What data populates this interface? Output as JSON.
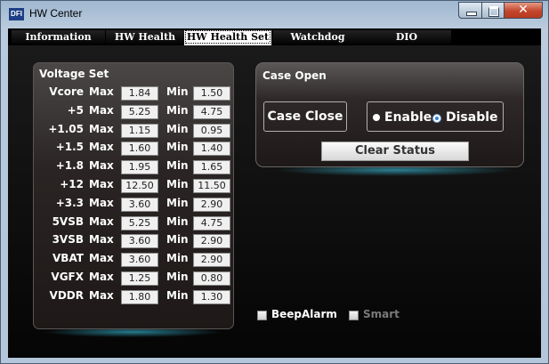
{
  "window": {
    "title": "HW Center",
    "logo_text": "DFI",
    "close_glyph": "✕"
  },
  "tabs": [
    {
      "label": "Information",
      "selected": false
    },
    {
      "label": "HW Health",
      "selected": false
    },
    {
      "label": "HW Health Set",
      "selected": true
    },
    {
      "label": "Watchdog",
      "selected": false
    },
    {
      "label": "DIO",
      "selected": false
    }
  ],
  "voltage_set": {
    "title": "Voltage Set",
    "max_label": "Max",
    "min_label": "Min",
    "rows": [
      {
        "name": "Vcore",
        "max": "1.84",
        "min": "1.50"
      },
      {
        "name": "+5",
        "max": "5.25",
        "min": "4.75"
      },
      {
        "name": "+1.05",
        "max": "1.15",
        "min": "0.95"
      },
      {
        "name": "+1.5",
        "max": "1.60",
        "min": "1.40"
      },
      {
        "name": "+1.8",
        "max": "1.95",
        "min": "1.65"
      },
      {
        "name": "+12",
        "max": "12.50",
        "min": "11.50"
      },
      {
        "name": "+3.3",
        "max": "3.60",
        "min": "2.90"
      },
      {
        "name": "5VSB",
        "max": "5.25",
        "min": "4.75"
      },
      {
        "name": "3VSB",
        "max": "3.60",
        "min": "2.90"
      },
      {
        "name": "VBAT",
        "max": "3.60",
        "min": "2.90"
      },
      {
        "name": "VGFX",
        "max": "1.25",
        "min": "0.80"
      },
      {
        "name": "VDDR",
        "max": "1.80",
        "min": "1.30"
      }
    ]
  },
  "case_open": {
    "title": "Case Open",
    "case_close_label": "Case Close",
    "enable_label": "Enable",
    "disable_label": "Disable",
    "selected": "Disable",
    "clear_status_label": "Clear Status"
  },
  "options": {
    "beep_alarm_label": "BeepAlarm",
    "beep_alarm_checked": false,
    "smart_label": "Smart",
    "smart_checked": false,
    "smart_enabled": false
  },
  "colors": {
    "panel_bg": "#000000",
    "accent_glow": "#3cc8e6",
    "radio_selected": "#3b82d6",
    "disabled_text": "#7a7a7a"
  }
}
